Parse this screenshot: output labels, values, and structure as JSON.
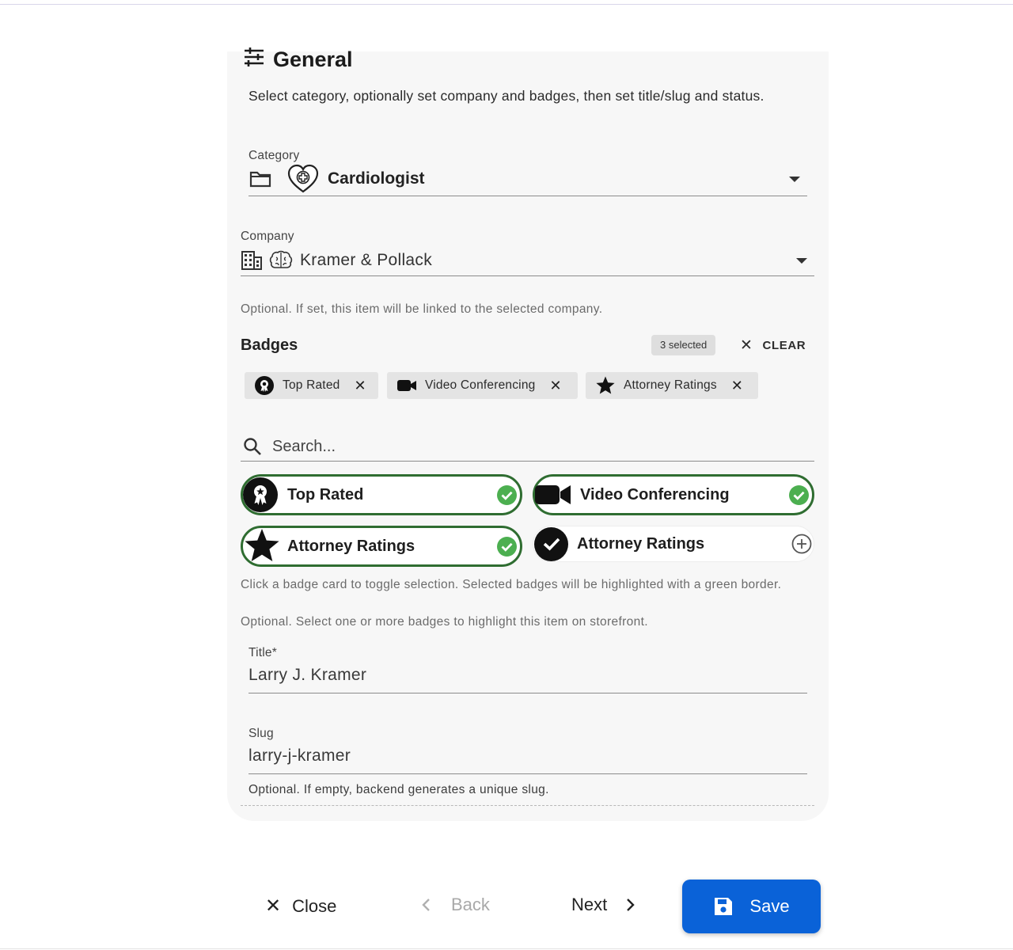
{
  "general": {
    "title": "General",
    "description": "Select category, optionally set company and badges, then set title/slug and status."
  },
  "category": {
    "label": "Category",
    "value": "Cardiologist"
  },
  "company": {
    "label": "Company",
    "value": "Kramer & Pollack",
    "helper": "Optional. If set, this item will be linked to the selected company."
  },
  "badges": {
    "title": "Badges",
    "selected_count": "3 selected",
    "clear_label": "CLEAR",
    "chips": [
      {
        "label": "Top Rated",
        "icon": "award-icon"
      },
      {
        "label": "Video Conferencing",
        "icon": "video-camera-icon"
      },
      {
        "label": "Attorney Ratings",
        "icon": "star-icon"
      }
    ],
    "search_placeholder": "Search...",
    "cards": [
      {
        "label": "Top Rated",
        "selected": true,
        "icon": "award-icon"
      },
      {
        "label": "Video Conferencing",
        "selected": true,
        "icon": "video-camera-icon"
      },
      {
        "label": "Attorney Ratings",
        "selected": true,
        "icon": "star-icon"
      },
      {
        "label": "Attorney Ratings",
        "selected": false,
        "icon": "check-circle-icon"
      }
    ],
    "helper_1": "Click a badge card to toggle selection. Selected badges will be highlighted with a green border.",
    "helper_2": "Optional. Select one or more badges to highlight this item on storefront."
  },
  "title_field": {
    "label": "Title*",
    "value": "Larry J. Kramer"
  },
  "slug_field": {
    "label": "Slug",
    "value": "larry-j-kramer",
    "helper": "Optional. If empty, backend generates a unique slug."
  },
  "footer": {
    "close": "Close",
    "back": "Back",
    "next": "Next",
    "save": "Save"
  },
  "colors": {
    "accent": "#0a62d8",
    "selected_border": "#2f6d31",
    "check_green": "#4caf50",
    "panel_bg": "#f7f7f7"
  }
}
